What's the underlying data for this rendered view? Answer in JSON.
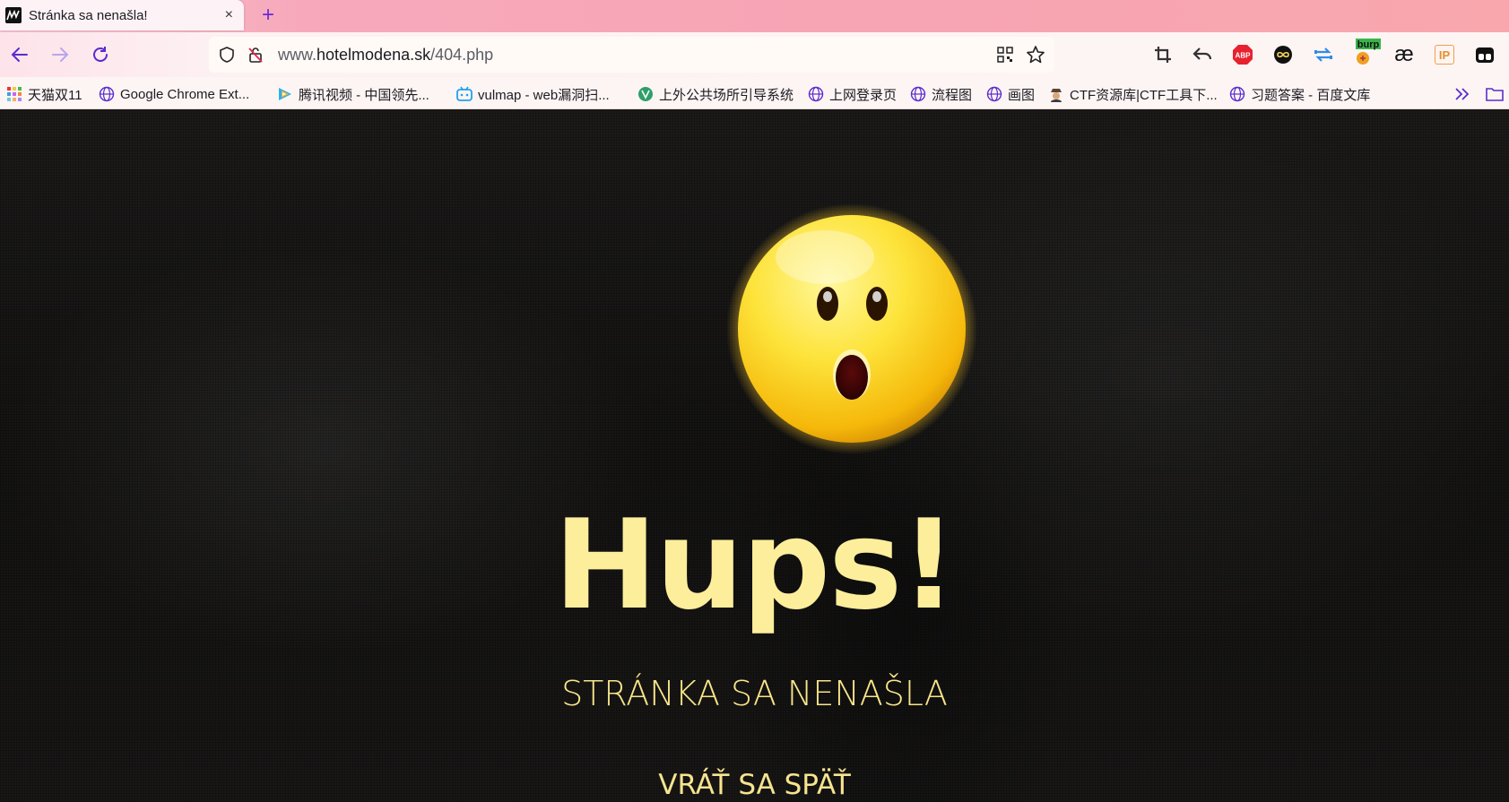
{
  "tab": {
    "title": "Stránka sa nenašla!",
    "close_glyph": "×",
    "new_tab_glyph": "+"
  },
  "url": {
    "prefix": "www.",
    "host": "hotelmodena.sk",
    "path": "/404.php"
  },
  "toolbar": {
    "burp_label": "burp",
    "ae_label": "æ",
    "ip_label": "IP",
    "abp_label": "ABP"
  },
  "bookmarks": [
    {
      "label": "天猫双11",
      "icon": "tmall-icon"
    },
    {
      "label": "Google Chrome Ext...",
      "icon": "globe-icon"
    },
    {
      "label": "腾讯视频 - 中国领先...",
      "icon": "tencent-video-icon"
    },
    {
      "label": "vulmap - web漏洞扫...",
      "icon": "bilibili-icon"
    },
    {
      "label": "上外公共场所引导系统",
      "icon": "vue-icon"
    },
    {
      "label": "上网登录页",
      "icon": "globe-icon"
    },
    {
      "label": "流程图",
      "icon": "globe-icon"
    },
    {
      "label": "画图",
      "icon": "globe-icon"
    },
    {
      "label": "CTF资源库|CTF工具下...",
      "icon": "spy-icon"
    },
    {
      "label": "习题答案 - 百度文库",
      "icon": "globe-icon"
    }
  ],
  "page": {
    "headline": "Hups!",
    "subtitle": "STRÁNKA SA NENAŠLA",
    "back_link": "VRÁŤ SA SPÄŤ"
  },
  "colors": {
    "accent_yellow": "#fdee9b",
    "tab_bar_pink": "#f7a4b4",
    "nav_purple": "#6b2bd6"
  }
}
